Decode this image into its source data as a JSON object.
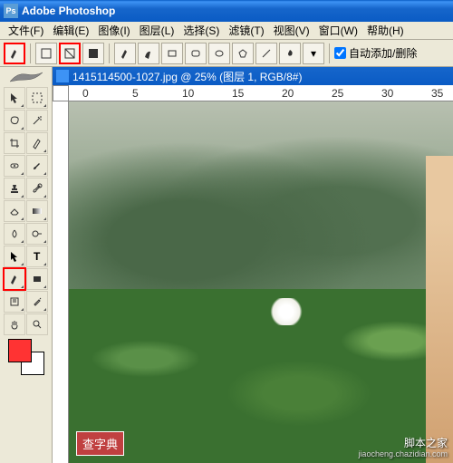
{
  "title": "Adobe Photoshop",
  "menu": [
    "文件(F)",
    "编辑(E)",
    "图像(I)",
    "图层(L)",
    "选择(S)",
    "滤镜(T)",
    "视图(V)",
    "窗口(W)",
    "帮助(H)"
  ],
  "optbar": {
    "auto_add_label": "自动添加/删除"
  },
  "doc": {
    "title": "1415114500-1027.jpg @ 25% (图层 1, RGB/8#)"
  },
  "ruler_marks": [
    "0",
    "5",
    "10",
    "15",
    "20",
    "25",
    "30",
    "35"
  ],
  "watermark": {
    "line1": "脚本之家",
    "line2": "jiaocheng.chazidian.com"
  },
  "badge": "查字典",
  "colors": {
    "fg": "#ff3333",
    "bg": "#ffffff"
  },
  "tool_names": [
    "move-tool",
    "marquee-tool",
    "lasso-tool",
    "magic-wand-tool",
    "crop-tool",
    "slice-tool",
    "healing-tool",
    "brush-tool",
    "stamp-tool",
    "history-brush-tool",
    "eraser-tool",
    "gradient-tool",
    "blur-tool",
    "dodge-tool",
    "path-select-tool",
    "type-tool",
    "pen-tool",
    "shape-tool",
    "notes-tool",
    "eyedropper-tool",
    "hand-tool",
    "zoom-tool"
  ]
}
